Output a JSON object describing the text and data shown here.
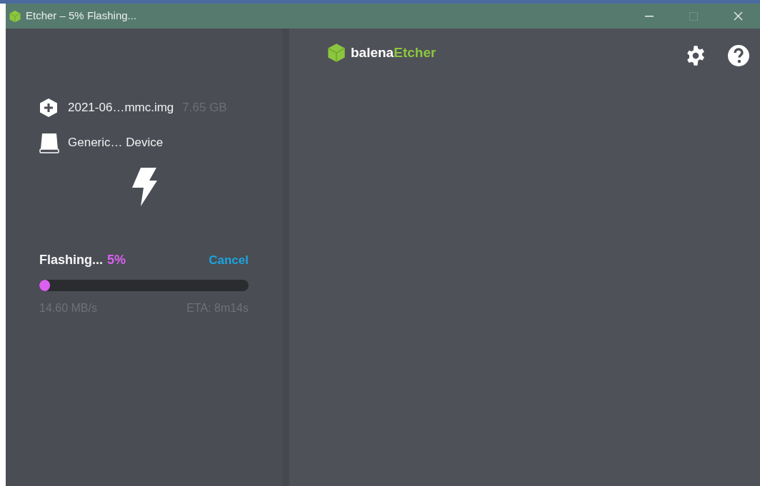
{
  "window": {
    "title": "Etcher – 5% Flashing...",
    "controls": [
      {
        "kind": "minimize",
        "disabled": false
      },
      {
        "kind": "maximize",
        "disabled": true
      },
      {
        "kind": "close",
        "disabled": false
      }
    ]
  },
  "source": {
    "name": "2021-06…mmc.img",
    "size": "7.65 GB"
  },
  "target": {
    "name": "Generic… Device"
  },
  "progress": {
    "label": "Flashing...",
    "percent": "5%",
    "cancel": "Cancel",
    "level": 0.05,
    "speed": "14.60 MB/s",
    "eta": "ETA: 8m14s"
  },
  "logo": {
    "brand": "balena",
    "product": "Etcher"
  }
}
